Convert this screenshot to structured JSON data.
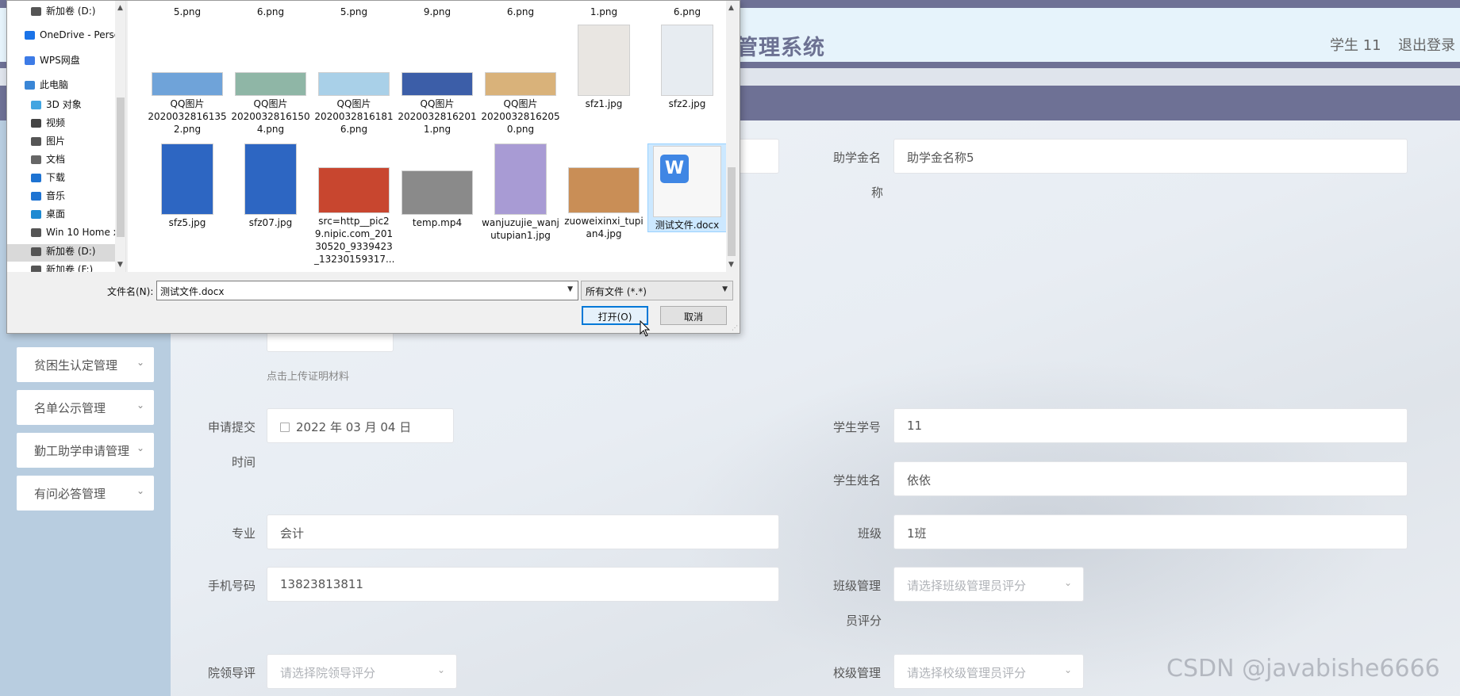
{
  "header": {
    "title": "息管理系统",
    "user": "学生 11",
    "logout": "退出登录"
  },
  "sidebar": {
    "items": [
      {
        "label": "贫困生认定管理"
      },
      {
        "label": "名单公示管理"
      },
      {
        "label": "勤工助学申请管理"
      },
      {
        "label": "有问必答管理"
      }
    ]
  },
  "form": {
    "scholarship_label_1": "助学金名",
    "scholarship_label_2": "称",
    "scholarship_value": "助学金名称5",
    "upload_hint": "点击上传证明材料",
    "submit_time_label_1": "申请提交",
    "submit_time_label_2": "时间",
    "submit_time_value": "2022 年 03 月 04 日",
    "student_no_label": "学生学号",
    "student_no_value": "11",
    "student_name_label": "学生姓名",
    "student_name_value": "依依",
    "major_label": "专业",
    "major_value": "会计",
    "class_label": "班级",
    "class_value": "1班",
    "phone_label": "手机号码",
    "phone_value": "13823813811",
    "class_admin_label_1": "班级管理",
    "class_admin_label_2": "员评分",
    "class_admin_placeholder": "请选择班级管理员评分",
    "college_leader_label": "院领导评",
    "college_leader_placeholder": "请选择院领导评分",
    "school_admin_label": "校级管理",
    "school_admin_placeholder": "请选择校级管理员评分"
  },
  "watermark": "CSDN @javabishe6666",
  "dialog": {
    "nav": [
      {
        "label": "新加卷 (D:)",
        "icon": "drive-icon",
        "color": "#555555"
      },
      {
        "label": "OneDrive - Perso",
        "icon": "cloud-icon",
        "color": "#1a73e8"
      },
      {
        "label": "WPS网盘",
        "icon": "cloud-icon",
        "color": "#3d7be6"
      },
      {
        "label": "此电脑",
        "icon": "computer-icon",
        "color": "#3a86d6"
      },
      {
        "label": "3D 对象",
        "icon": "cube-icon",
        "color": "#41a5e1"
      },
      {
        "label": "视频",
        "icon": "video-icon",
        "color": "#444444"
      },
      {
        "label": "图片",
        "icon": "picture-icon",
        "color": "#555555"
      },
      {
        "label": "文档",
        "icon": "document-icon",
        "color": "#666666"
      },
      {
        "label": "下载",
        "icon": "download-icon",
        "color": "#1e73d2"
      },
      {
        "label": "音乐",
        "icon": "music-icon",
        "color": "#1e73d2"
      },
      {
        "label": "桌面",
        "icon": "desktop-icon",
        "color": "#1e8ad2"
      },
      {
        "label": "Win 10 Home x",
        "icon": "drive-icon",
        "color": "#555555"
      },
      {
        "label": "新加卷 (D:)",
        "icon": "drive-icon",
        "color": "#555555"
      },
      {
        "label": "新加卷 (F:)",
        "icon": "drive-icon",
        "color": "#555555"
      }
    ],
    "files_row0": [
      "5.png",
      "6.png",
      "5.png",
      "9.png",
      "6.png",
      "1.png",
      "6.png"
    ],
    "files_row1": [
      {
        "name": "QQ图片\n2020032816135\n2.png",
        "color": "#6fa3d9"
      },
      {
        "name": "QQ图片\n2020032816150\n4.png",
        "color": "#8fb6a6"
      },
      {
        "name": "QQ图片\n2020032816181\n6.png",
        "color": "#a9d0e8"
      },
      {
        "name": "QQ图片\n2020032816201\n1.png",
        "color": "#3c5ea8"
      },
      {
        "name": "QQ图片\n2020032816205\n0.png",
        "color": "#d9b27a"
      },
      {
        "name": "sfz1.jpg",
        "color": "#e9e6e2"
      },
      {
        "name": "sfz2.jpg",
        "color": "#e7ecf1"
      }
    ],
    "files_row2": [
      {
        "name": "sfz5.jpg",
        "color": "#2d66c2"
      },
      {
        "name": "sfz07.jpg",
        "color": "#2d66c2"
      },
      {
        "name": "src=http__pic2\n9.nipic.com_201\n30520_9339423\n_13230159317...",
        "color": "#c8462f"
      },
      {
        "name": "temp.mp4",
        "color": "#8a8a8a"
      },
      {
        "name": "wanjuzujie_wanj\nutupian1.jpg",
        "color": "#a89bd4"
      },
      {
        "name": "zuoweixinxi_tupi\nan4.jpg",
        "color": "#c98e56"
      },
      {
        "name": "测试文件.docx",
        "color": "#3f86e4"
      }
    ],
    "filename_label": "文件名(N):",
    "filename_value": "测试文件.docx",
    "filetype_value": "所有文件 (*.*)",
    "open_button": "打开(O)",
    "cancel_button": "取消"
  }
}
